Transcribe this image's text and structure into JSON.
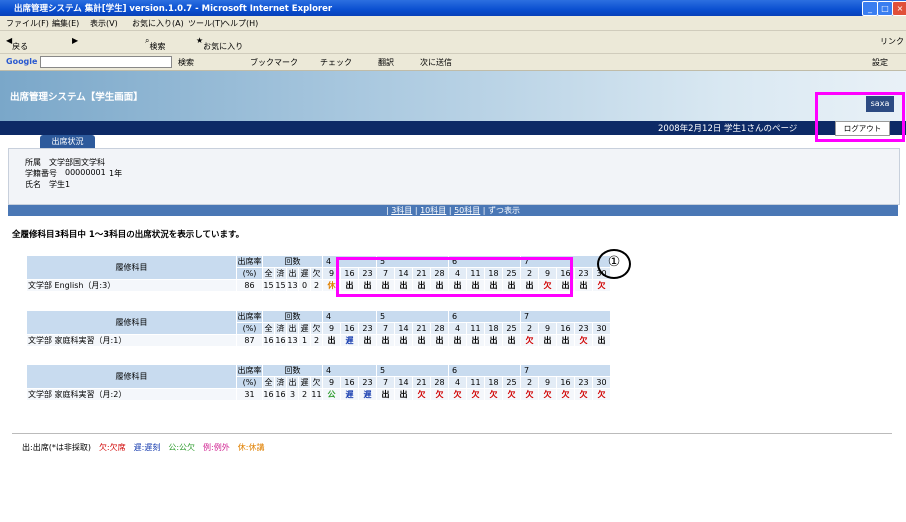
{
  "window": {
    "title": "出席管理システム 集計[学生] version.1.0.7 - Microsoft Internet Explorer",
    "menu": [
      "ファイル(F)",
      "編集(E)",
      "表示(V)",
      "お気に入り(A)",
      "ツール(T)",
      "ヘルプ(H)"
    ],
    "toolbar": [
      "戻る",
      "検索",
      "お気に入り"
    ],
    "links_label": "リンク",
    "google": {
      "label": "Google",
      "search": "検索",
      "bookmarks": "ブックマーク",
      "check": "チェック",
      "translate": "翻訳",
      "send": "次に送信",
      "settings": "設定"
    }
  },
  "app": {
    "name": "出席管理システム【学生画面】",
    "logo": "saxa",
    "date_user": "2008年2月12日  学生1さんのページ",
    "logout": "ログアウト",
    "tab": "出席状況"
  },
  "student": {
    "affil_label": "所属",
    "affil": "文学部国文学科",
    "id_label": "学籍番号",
    "id": "00000001",
    "year": "1年",
    "name_label": "氏名",
    "name": "学生1"
  },
  "filter": [
    "3科目",
    "10科目",
    "50科目",
    "ずつ表示"
  ],
  "summary": "全履修科目3科目中  1〜3科目の出席状況を表示しています。",
  "table_headers": {
    "course": "履修科目",
    "rate": "出席率",
    "rate_unit": "(%)",
    "count": "回数",
    "cols": [
      "全",
      "済",
      "出",
      "遅",
      "欠"
    ]
  },
  "months": [
    {
      "m": "4",
      "days": [
        "9",
        "16",
        "23"
      ]
    },
    {
      "m": "5",
      "days": [
        "7",
        "14",
        "21",
        "28"
      ]
    },
    {
      "m": "6",
      "days": [
        "4",
        "11",
        "18",
        "25"
      ]
    },
    {
      "m": "7",
      "days": [
        "2",
        "9",
        "16",
        "23",
        "30"
      ]
    }
  ],
  "courses": [
    {
      "name": "文学部 English（月:3）",
      "rate": "86",
      "counts": [
        "15",
        "15",
        "13",
        "0",
        "2"
      ],
      "marks": [
        "休",
        "出",
        "出",
        "出",
        "出",
        "出",
        "出",
        "出",
        "出",
        "出",
        "出",
        "出",
        "欠",
        "出",
        "出",
        "欠"
      ]
    },
    {
      "name": "文学部 家庭科実習（月:1）",
      "rate": "87",
      "counts": [
        "16",
        "16",
        "13",
        "1",
        "2"
      ],
      "marks": [
        "出",
        "遅",
        "出",
        "出",
        "出",
        "出",
        "出",
        "出",
        "出",
        "出",
        "出",
        "欠",
        "出",
        "出",
        "欠",
        "出"
      ]
    },
    {
      "name": "文学部 家庭科実習（月:2）",
      "rate": "31",
      "counts": [
        "16",
        "16",
        "3",
        "2",
        "11"
      ],
      "marks": [
        "公",
        "遅",
        "遅",
        "出",
        "出",
        "欠",
        "欠",
        "欠",
        "欠",
        "欠",
        "欠",
        "欠",
        "欠",
        "欠",
        "欠",
        "欠"
      ]
    }
  ],
  "legend": [
    "出:出席(*は非採取)",
    "欠:欠席",
    "遅:遅刻",
    "公:公欠",
    "例:例外",
    "休:休講"
  ],
  "annotation": "①"
}
